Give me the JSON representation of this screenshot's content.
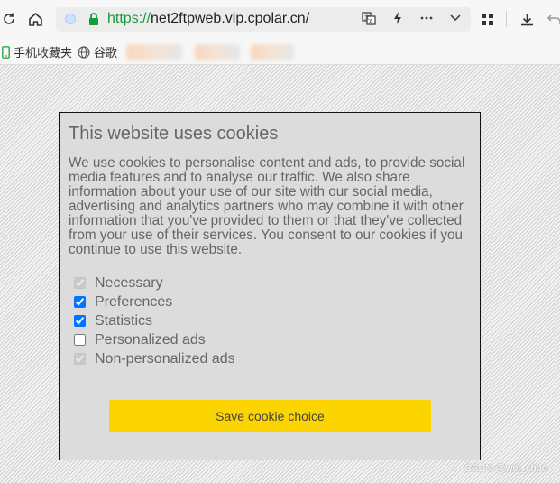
{
  "browser": {
    "url_scheme": "https://",
    "url_host": "net2ftpweb.vip.cpolar.cn/",
    "toolbar_icons": [
      "refresh-icon",
      "home-icon",
      "site-info-icon",
      "lock-icon",
      "translate-icon",
      "lightning-icon",
      "more-icon",
      "chevron-down-icon",
      "apps-grid-icon",
      "download-icon",
      "undo-icon"
    ]
  },
  "bookmarks": {
    "items": [
      {
        "label": "手机收藏夹",
        "icon": "phone-icon"
      },
      {
        "label": "谷歌",
        "icon": "globe-icon"
      }
    ]
  },
  "dialog": {
    "title": "This website uses cookies",
    "body": "We use cookies to personalise content and ads, to provide social media features and to analyse our traffic. We also share information about your use of our site with our social media, advertising and analytics partners who may combine it with other information that you've provided to them or that they've collected from your use of their services. You consent to our cookies if you continue to use this website.",
    "options": [
      {
        "label": "Necessary",
        "checked": true,
        "disabled": true
      },
      {
        "label": "Preferences",
        "checked": true,
        "disabled": false
      },
      {
        "label": "Statistics",
        "checked": true,
        "disabled": false
      },
      {
        "label": "Personalized ads",
        "checked": false,
        "disabled": false
      },
      {
        "label": "Non-personalized ads",
        "checked": true,
        "disabled": true
      }
    ],
    "save_label": "Save cookie choice"
  },
  "watermark": "CSDN @wei_shuo",
  "colors": {
    "accent_button": "#fcd400",
    "url_scheme": "#1a9a3a"
  }
}
